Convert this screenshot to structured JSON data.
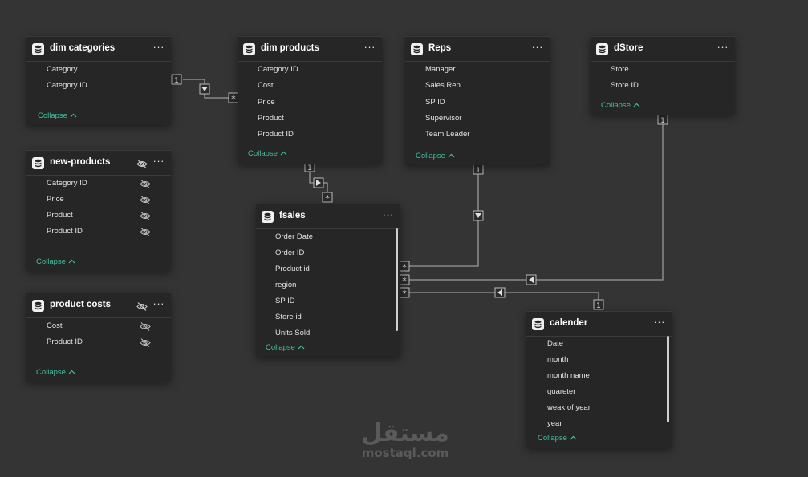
{
  "colors": {
    "background": "#343434",
    "card": "#262626",
    "collapse_accent": "#3fc0a0",
    "connector": "#9a9a9a"
  },
  "icons": {
    "table": "table-icon",
    "more": "more-options-icon",
    "hidden": "eye-slash-icon",
    "collapse": "chevron-up-icon"
  },
  "tables": {
    "dim_categories": {
      "title": "dim categories",
      "fields": [
        "Category",
        "Category ID"
      ],
      "collapse": "Collapse"
    },
    "dim_products": {
      "title": "dim products",
      "fields": [
        "Category ID",
        "Cost",
        "Price",
        "Product",
        "Product ID"
      ],
      "collapse": "Collapse"
    },
    "reps": {
      "title": "Reps",
      "fields": [
        "Manager",
        "Sales Rep",
        "SP ID",
        "Supervisor",
        "Team Leader"
      ],
      "collapse": "Collapse"
    },
    "dstore": {
      "title": "dStore",
      "fields": [
        "Store",
        "Store ID"
      ],
      "collapse": "Collapse"
    },
    "new_products": {
      "title": "new-products",
      "fields": [
        "Category ID",
        "Price",
        "Product",
        "Product ID"
      ],
      "collapse": "Collapse",
      "hidden": true
    },
    "product_costs": {
      "title": "product costs",
      "fields": [
        "Cost",
        "Product ID"
      ],
      "collapse": "Collapse",
      "hidden": true
    },
    "fsales": {
      "title": "fsales",
      "fields": [
        "Order Date",
        "Order ID",
        "Product id",
        "region",
        "SP ID",
        "Store id",
        "Units Sold"
      ],
      "collapse": "Collapse"
    },
    "calender": {
      "title": "calender",
      "fields": [
        "Date",
        "month",
        "month name",
        "quareter",
        "weak of year",
        "year"
      ],
      "collapse": "Collapse"
    }
  },
  "relationships": [
    {
      "from": "dim categories",
      "to": "dim products",
      "one": "1",
      "many": "*"
    },
    {
      "from": "dim products",
      "to": "fsales",
      "one": "1",
      "many": "*"
    },
    {
      "from": "Reps",
      "to": "fsales",
      "one": "1",
      "many": "*"
    },
    {
      "from": "dStore",
      "to": "fsales",
      "one": "1",
      "many": "*"
    },
    {
      "from": "calender",
      "to": "fsales",
      "one": "1",
      "many": "*"
    }
  ],
  "watermark": {
    "arabic": "مستقل",
    "latin": "mostaql.com"
  }
}
